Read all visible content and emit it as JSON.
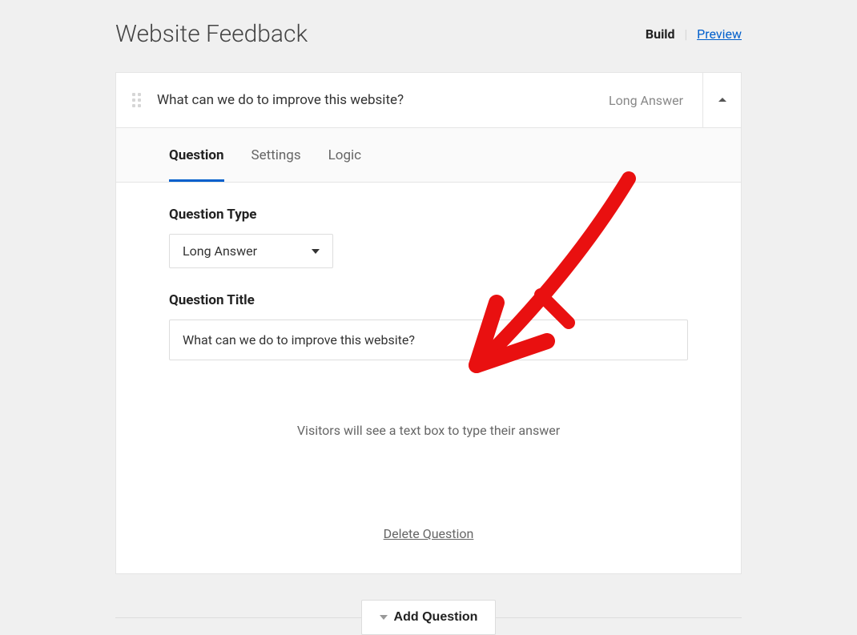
{
  "header": {
    "title": "Website Feedback",
    "nav": {
      "build": "Build",
      "preview": "Preview"
    }
  },
  "question_card": {
    "header": {
      "title": "What can we do to improve this website?",
      "type_label": "Long Answer"
    },
    "tabs": [
      {
        "label": "Question",
        "active": true
      },
      {
        "label": "Settings",
        "active": false
      },
      {
        "label": "Logic",
        "active": false
      }
    ],
    "body": {
      "type_label": "Question Type",
      "type_value": "Long Answer",
      "title_label": "Question Title",
      "title_value": "What can we do to improve this website?",
      "helper": "Visitors will see a text box to type their answer",
      "delete": "Delete Question"
    }
  },
  "add_button": "Add Question"
}
